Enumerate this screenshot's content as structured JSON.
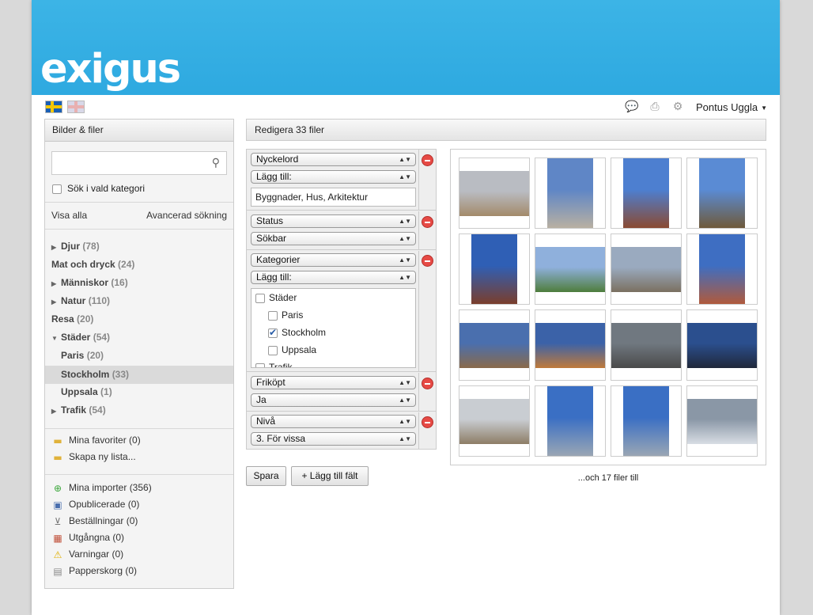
{
  "brand": {
    "logo_text": "exigus",
    "accent": "#33aee2"
  },
  "topbar": {
    "flags": [
      "swedish-flag",
      "uk-flag"
    ],
    "icons": [
      "chat-icon",
      "upload-icon",
      "gear-icon"
    ],
    "user_name": "Pontus Uggla"
  },
  "sidebar": {
    "title": "Bilder & filer",
    "search_placeholder": "",
    "search_in_category": "Sök i vald kategori",
    "show_all": "Visa alla",
    "advanced_search": "Avancerad sökning",
    "categories": [
      {
        "label": "Djur",
        "count": "(78)",
        "expandable": true,
        "expanded": false,
        "level": 0
      },
      {
        "label": "Mat och dryck",
        "count": "(24)",
        "expandable": false,
        "level": 0
      },
      {
        "label": "Människor",
        "count": "(16)",
        "expandable": true,
        "expanded": false,
        "level": 0
      },
      {
        "label": "Natur",
        "count": "(110)",
        "expandable": true,
        "expanded": false,
        "level": 0
      },
      {
        "label": "Resa",
        "count": "(20)",
        "expandable": false,
        "level": 0
      },
      {
        "label": "Städer",
        "count": "(54)",
        "expandable": true,
        "expanded": true,
        "level": 0
      },
      {
        "label": "Paris",
        "count": "(20)",
        "expandable": false,
        "level": 1
      },
      {
        "label": "Stockholm",
        "count": "(33)",
        "expandable": false,
        "level": 1,
        "selected": true
      },
      {
        "label": "Uppsala",
        "count": "(1)",
        "expandable": false,
        "level": 1
      },
      {
        "label": "Trafik",
        "count": "(54)",
        "expandable": true,
        "expanded": false,
        "level": 0
      }
    ],
    "lists": [
      {
        "label": "Mina favoriter (0)",
        "icon": "folder-icon"
      },
      {
        "label": "Skapa ny lista...",
        "icon": "new-folder-icon"
      }
    ],
    "status_links": [
      {
        "label": "Mina importer (356)",
        "icon": "import-icon"
      },
      {
        "label": "Opublicerade (0)",
        "icon": "unpublished-icon"
      },
      {
        "label": "Beställningar (0)",
        "icon": "cart-icon"
      },
      {
        "label": "Utgångna (0)",
        "icon": "calendar-icon"
      },
      {
        "label": "Varningar (0)",
        "icon": "warning-icon"
      },
      {
        "label": "Papperskorg (0)",
        "icon": "trash-icon"
      }
    ]
  },
  "editor": {
    "title": "Redigera 33 filer",
    "fields": {
      "keywords": {
        "field": "Nyckelord",
        "mode": "Lägg till:",
        "value": "Byggnader, Hus, Arkitektur"
      },
      "status": {
        "field": "Status",
        "value": "Sökbar"
      },
      "categories": {
        "field": "Kategorier",
        "mode": "Lägg till:",
        "tree": [
          {
            "label": "Städer",
            "checked": false,
            "level": 0
          },
          {
            "label": "Paris",
            "checked": false,
            "level": 1
          },
          {
            "label": "Stockholm",
            "checked": true,
            "level": 1
          },
          {
            "label": "Uppsala",
            "checked": false,
            "level": 1
          },
          {
            "label": "Trafik",
            "checked": false,
            "level": 0
          }
        ]
      },
      "royalty_free": {
        "field": "Friköpt",
        "value": "Ja"
      },
      "level": {
        "field": "Nivå",
        "value": "3. För vissa"
      }
    },
    "save_button": "Spara",
    "add_field_button": "+ Lägg till fält"
  },
  "gallery": {
    "thumbnails": [
      {
        "orientation": "landscape",
        "colors": [
          "#b9bcc2",
          "#a38a6a"
        ]
      },
      {
        "orientation": "portrait",
        "colors": [
          "#5f86c6",
          "#b8b0a2"
        ]
      },
      {
        "orientation": "portrait",
        "colors": [
          "#4d7fd0",
          "#8a4a32"
        ]
      },
      {
        "orientation": "portrait",
        "colors": [
          "#5a8bd4",
          "#6f5a3a"
        ]
      },
      {
        "orientation": "portrait",
        "colors": [
          "#2f5fb5",
          "#7a3e2c"
        ]
      },
      {
        "orientation": "landscape",
        "colors": [
          "#8fb0dc",
          "#4e7d3c"
        ]
      },
      {
        "orientation": "landscape",
        "colors": [
          "#9aaabf",
          "#7b7060"
        ]
      },
      {
        "orientation": "portrait",
        "colors": [
          "#3e6ec2",
          "#b05a3c"
        ]
      },
      {
        "orientation": "landscape",
        "colors": [
          "#4a6fae",
          "#8a6a4a"
        ]
      },
      {
        "orientation": "landscape",
        "colors": [
          "#3b62a8",
          "#c07a3a"
        ]
      },
      {
        "orientation": "landscape",
        "colors": [
          "#707880",
          "#4a4a4a"
        ]
      },
      {
        "orientation": "landscape",
        "colors": [
          "#2b4f8e",
          "#20283a"
        ]
      },
      {
        "orientation": "landscape",
        "colors": [
          "#c9cdd2",
          "#8d7d66"
        ]
      },
      {
        "orientation": "portrait",
        "colors": [
          "#3a6fc4",
          "#9aa6b4"
        ]
      },
      {
        "orientation": "portrait",
        "colors": [
          "#3a6fc4",
          "#9aa6b4"
        ]
      },
      {
        "orientation": "landscape",
        "colors": [
          "#8a97a6",
          "#d8dde4"
        ]
      }
    ],
    "more_text": "...och 17 filer till"
  }
}
